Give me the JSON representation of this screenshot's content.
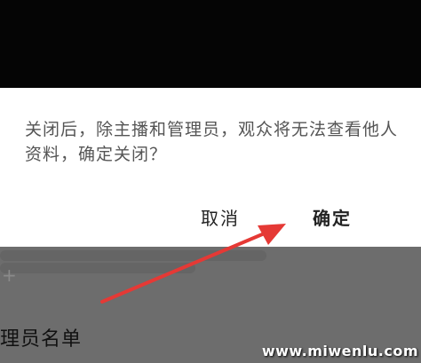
{
  "dialog": {
    "message": "关闭后，除主播和管理员，观众将无法查看他人资料，确定关闭？",
    "cancel_label": "取消",
    "confirm_label": "确定"
  },
  "background": {
    "plus_symbol": "+",
    "admin_list_title": "理员名单"
  },
  "watermark": "www.miwenlu.com",
  "colors": {
    "arrow": "#e53935",
    "dialog_bg": "#ffffff",
    "overlay": "#6d6d6d"
  }
}
